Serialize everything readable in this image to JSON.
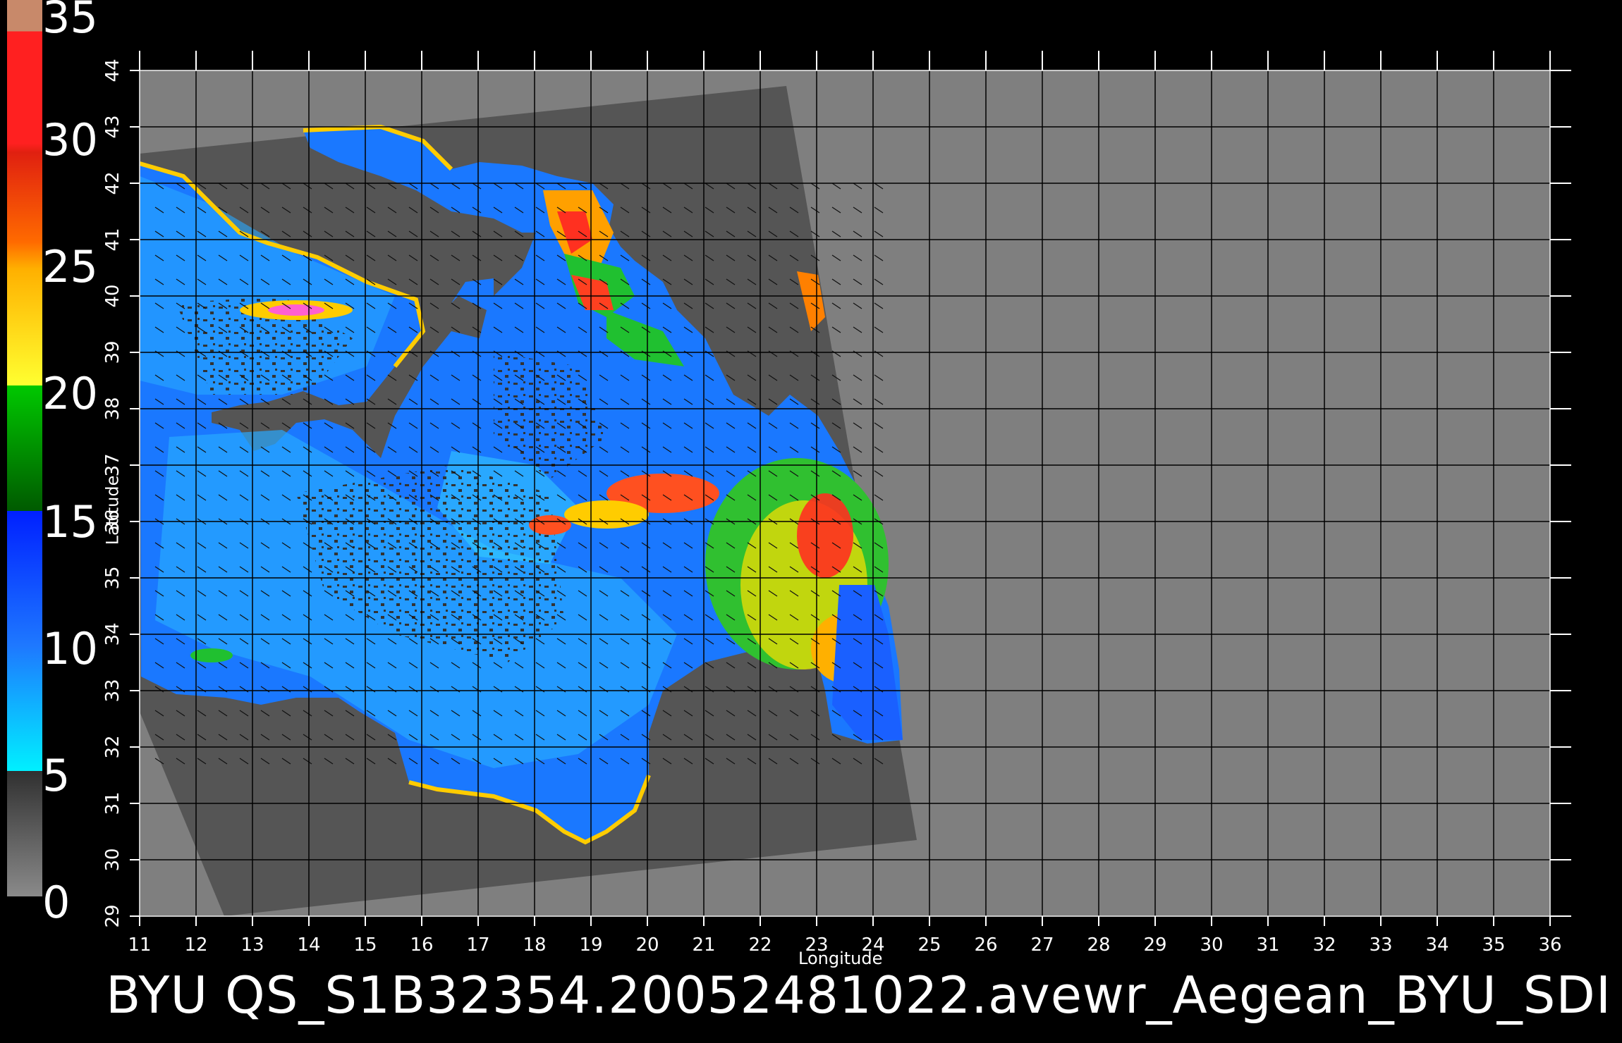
{
  "title": "BYU QS_S1B32354.20052481022.avewr_Aegean_BYU_SDI",
  "colorbar": {
    "labels": [
      "35",
      "30",
      "25",
      "20",
      "15",
      "10",
      "5",
      "0"
    ],
    "colors": [
      "#c8896a",
      "#ff2020",
      "#ff5a00",
      "#ffc800",
      "#00b400",
      "#006400",
      "#0000ff",
      "#00e8ff",
      "#404040",
      "#808080"
    ]
  },
  "x_axis": {
    "label": "Longitude",
    "ticks": [
      "11",
      "12",
      "13",
      "14",
      "15",
      "16",
      "17",
      "18",
      "19",
      "20",
      "21",
      "22",
      "23",
      "24",
      "25",
      "26",
      "27",
      "28",
      "29",
      "30",
      "31",
      "32",
      "33",
      "34",
      "35",
      "36"
    ]
  },
  "y_axis": {
    "label": "Latitude",
    "ticks": [
      "29",
      "30",
      "31",
      "32",
      "33",
      "34",
      "35",
      "36",
      "37",
      "38",
      "39",
      "40",
      "41",
      "42",
      "43",
      "44"
    ]
  },
  "colors": {
    "background": "#000000",
    "swath": "#555555",
    "no_data": "#7f7f7f",
    "grid": "#000000",
    "land_gray": "#4a4a4a"
  }
}
